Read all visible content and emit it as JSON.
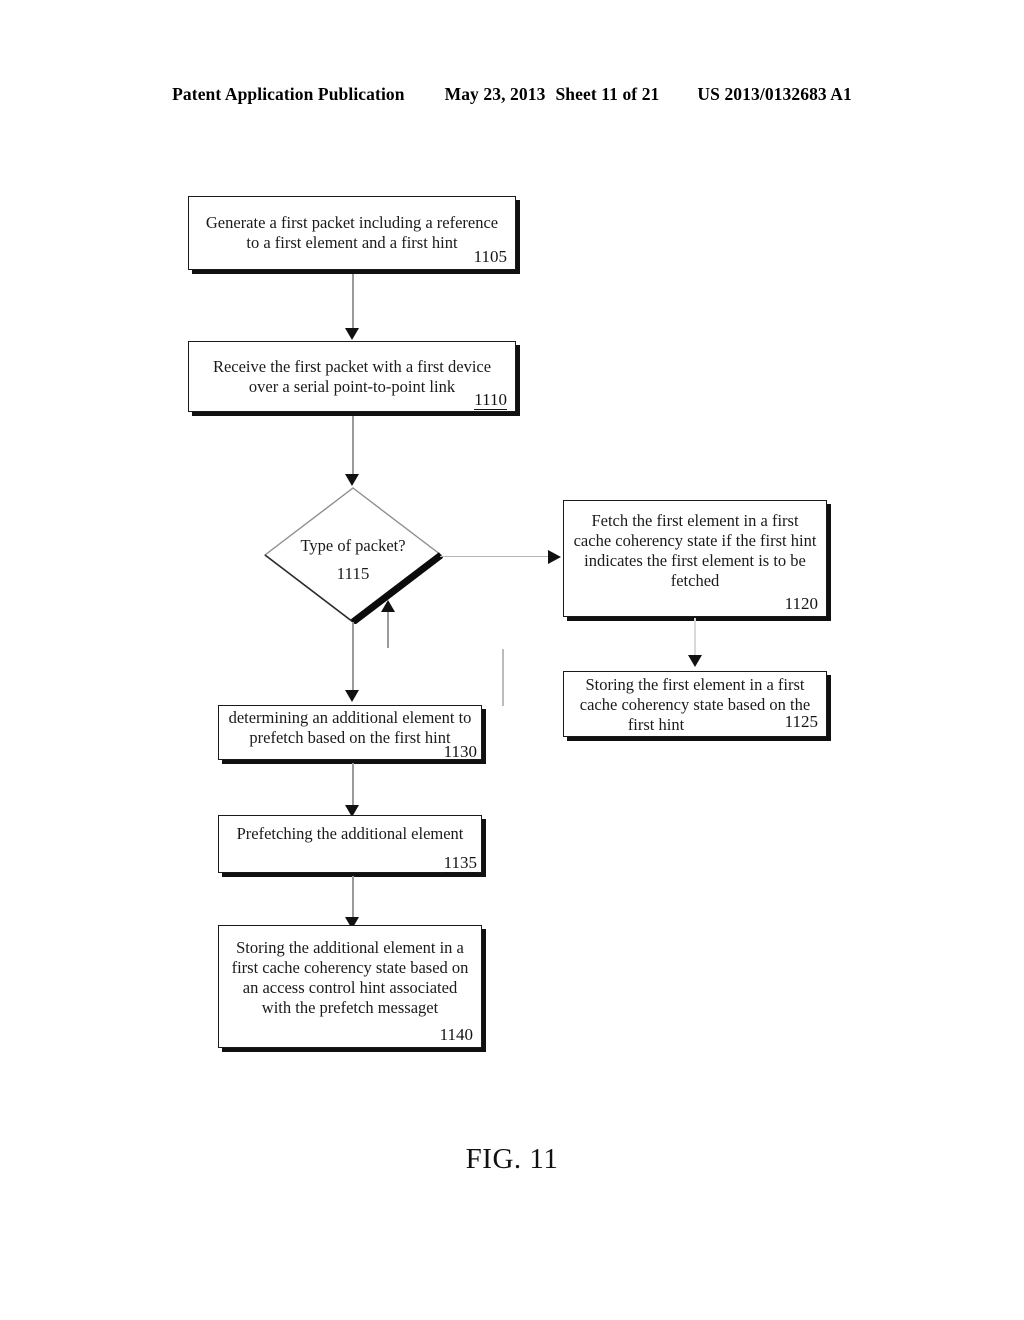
{
  "header": {
    "publication": "Patent Application Publication",
    "date": "May 23, 2013",
    "sheet": "Sheet 11 of 21",
    "patent_number": "US 2013/0132683 A1"
  },
  "figure": {
    "caption": "FIG. 11"
  },
  "flowchart": {
    "nodes": [
      {
        "id": "1105",
        "shape": "process",
        "ref": "1105",
        "lines": [
          "Generate a first packet including a reference",
          "to a first element and a first hint"
        ]
      },
      {
        "id": "1110",
        "shape": "process",
        "ref": "1110",
        "lines": [
          "Receive the first packet with a first device",
          "over a serial point-to-point link"
        ]
      },
      {
        "id": "1115",
        "shape": "decision",
        "ref": "1115",
        "lines": [
          "Type of packet?"
        ]
      },
      {
        "id": "1120",
        "shape": "process",
        "ref": "1120",
        "lines": [
          "Fetch the first element in a first",
          "cache coherency state if the first hint",
          "indicates the first element is to be",
          "fetched"
        ]
      },
      {
        "id": "1125",
        "shape": "process",
        "ref": "1125",
        "lines": [
          "Storing the first element in a first",
          "cache coherency state based on the",
          "first hint"
        ]
      },
      {
        "id": "1130",
        "shape": "process",
        "ref": "1130",
        "lines": [
          "determining an additional element to",
          "prefetch based on the first hint"
        ]
      },
      {
        "id": "1135",
        "shape": "process",
        "ref": "1135",
        "lines": [
          "Prefetching the additional element"
        ]
      },
      {
        "id": "1140",
        "shape": "process",
        "ref": "1140",
        "lines": [
          "Storing the additional element in a",
          "first cache coherency state based on",
          "an access control hint associated",
          "with the prefetch messaget"
        ]
      }
    ],
    "edges": [
      {
        "from": "1105",
        "to": "1110",
        "direction": "down"
      },
      {
        "from": "1110",
        "to": "1115",
        "direction": "down"
      },
      {
        "from": "1115",
        "to": "1120",
        "direction": "right"
      },
      {
        "from": "1120",
        "to": "1125",
        "direction": "down"
      },
      {
        "from": "1115",
        "to": "1130",
        "direction": "down"
      }
    ]
  },
  "colors": {
    "ink": "#111111",
    "paper": "#ffffff",
    "connector": "#9a9a9a"
  }
}
